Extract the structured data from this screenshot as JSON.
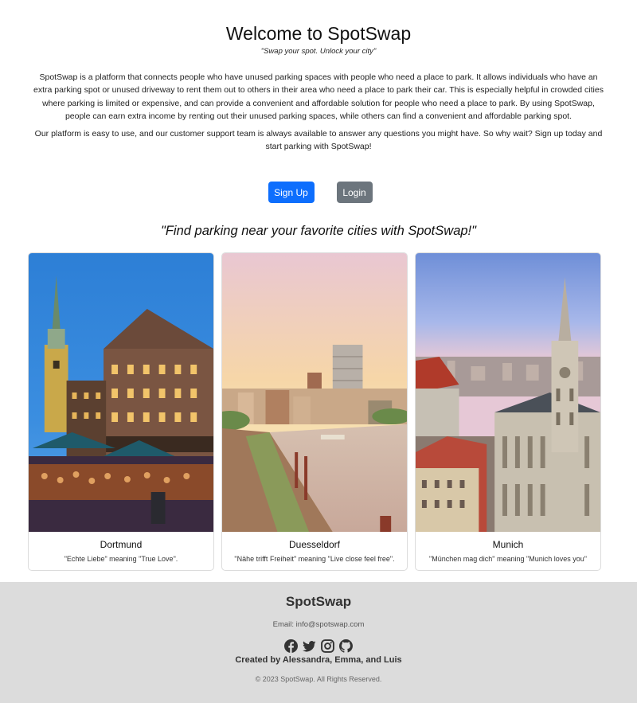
{
  "hero": {
    "title": "Welcome to SpotSwap",
    "tagline": "\"Swap your spot. Unlock your city\"",
    "paragraph1": "SpotSwap is a platform that connects people who have unused parking spaces with people who need a place to park. It allows individuals who have an extra parking spot or unused driveway to rent them out to others in their area who need a place to park their car. This is especially helpful in crowded cities where parking is limited or expensive, and can provide a convenient and affordable solution for people who need a place to park. By using SpotSwap, people can earn extra income by renting out their unused parking spaces, while others can find a convenient and affordable parking spot.",
    "paragraph2": "Our platform is easy to use, and our customer support team is always available to answer any questions you might have. So why wait? Sign up today and start parking with SpotSwap!"
  },
  "buttons": {
    "signup_label": "Sign Up",
    "login_label": "Login",
    "primary_color": "#0d6efd",
    "secondary_color": "#6c757d"
  },
  "quote": "\"Find parking near your favorite cities with SpotSwap!\"",
  "cities": [
    {
      "name": "Dortmund",
      "caption": "\"Echte Liebe\" meaning \"True Love\"."
    },
    {
      "name": "Duesseldorf",
      "caption": "\"Nähe trifft Freiheit\" meaning \"Live close feel free\"."
    },
    {
      "name": "Munich",
      "caption": "\"München mag dich\" meaning \"Munich loves you\""
    }
  ],
  "footer": {
    "brand": "SpotSwap",
    "email": "Email: info@spotswap.com",
    "social_icons": [
      "facebook-icon",
      "twitter-icon",
      "instagram-icon",
      "github-icon"
    ],
    "credit": "Created by Alessandra, Emma, and Luis",
    "copyright": "© 2023 SpotSwap. All Rights Reserved.",
    "background": "#dcdcdc"
  }
}
